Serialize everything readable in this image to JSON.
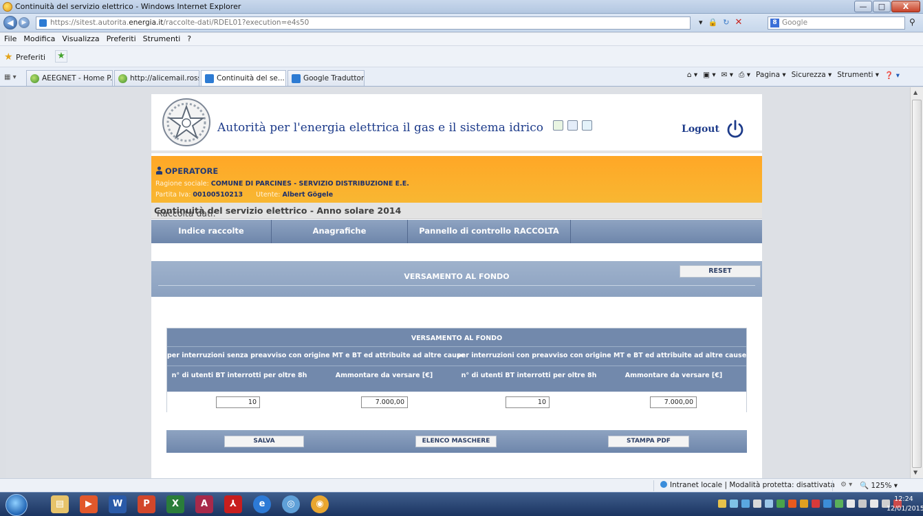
{
  "window": {
    "title": "Continuità del servizio elettrico - Windows Internet Explorer",
    "minimize": "—",
    "maximize": "□",
    "close": "X"
  },
  "browser": {
    "url_prefix": "https://sitest.autorita.",
    "url_domain": "energia.it",
    "url_suffix": "/raccolte-dati/RDEL01?execution=e4s50",
    "search_placeholder": "Google",
    "menu": [
      "File",
      "Modifica",
      "Visualizza",
      "Preferiti",
      "Strumenti",
      "?"
    ],
    "favorites_label": "Preferiti",
    "tabs": [
      {
        "label": "AEEGNET - Home P..."
      },
      {
        "label": "http://alicemail.ross..."
      },
      {
        "label": "Continuità del se...",
        "close": "X"
      },
      {
        "label": "Google Traduttore"
      }
    ],
    "commands": [
      "Pagina ▾",
      "Sicurezza ▾",
      "Strumenti ▾"
    ]
  },
  "header": {
    "org_name": "Autorità per l'energia elettrica il gas e il sistema idrico",
    "logout": "Logout"
  },
  "operator": {
    "title": "OPERATORE",
    "ragione_label": "Ragione sociale:",
    "ragione_value": "COMUNE DI PARCINES - SERVIZIO DISTRIBUZIONE E.E.",
    "piva_label": "Partita Iva:",
    "piva_value": "00100510213",
    "utente_label": "Utente:",
    "utente_value": "Albert Gögele"
  },
  "raccolta": {
    "label": "Raccolta dati:",
    "value": "Continuità del servizio elettrico - Anno solare 2014"
  },
  "nav": {
    "items": [
      "Indice raccolte",
      "Anagrafiche",
      "Pannello di controllo RACCOLTA"
    ]
  },
  "section": {
    "title": "VERSAMENTO AL FONDO",
    "reset": "RESET"
  },
  "table": {
    "title": "VERSAMENTO AL FONDO",
    "group_left": "per interruzioni senza preavviso con origine MT e BT ed attribuite ad altre cause",
    "group_right": "per interruzioni con preavviso con origine MT e BT ed attribuite ad altre cause",
    "col_utenti": "n° di utenti BT interrotti per oltre 8h",
    "col_ammontare": "Ammontare da versare [€]",
    "values": [
      "10",
      "7.000,00",
      "10",
      "7.000,00"
    ]
  },
  "actions": {
    "salva": "SALVA",
    "elenco": "ELENCO MASCHERE",
    "stampa": "STAMPA PDF"
  },
  "status": {
    "zone": "Intranet locale | Modalità protetta: disattivata",
    "zoom": "125%"
  },
  "taskbar": {
    "time": "12:24",
    "date": "12/01/2015"
  },
  "colors": {
    "orange": "#ffa726",
    "nav_blue": "#6e86ab",
    "brand_blue": "#1d3b8a"
  }
}
